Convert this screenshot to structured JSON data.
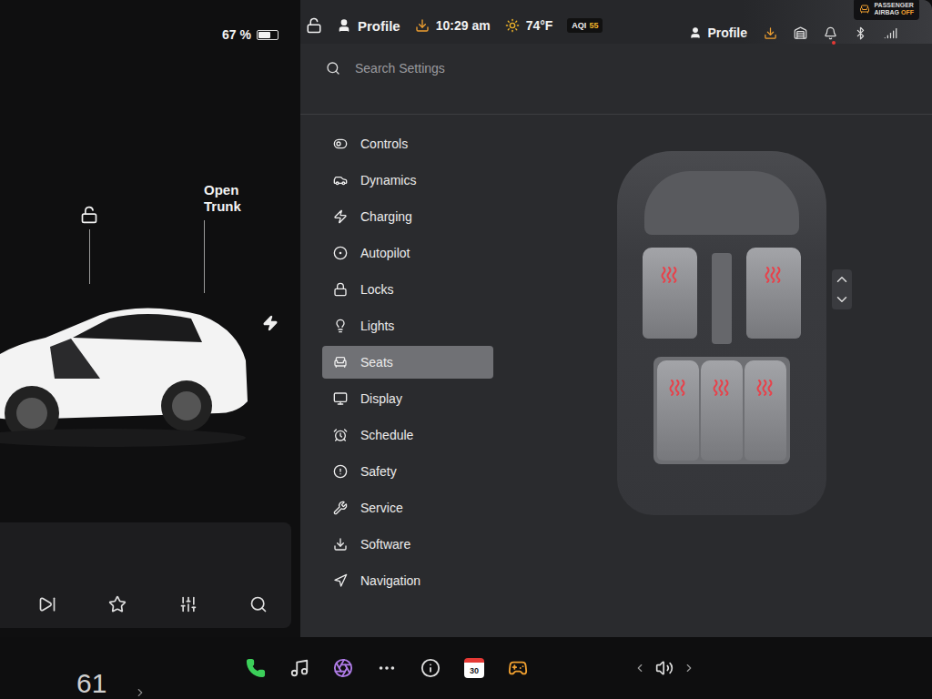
{
  "status": {
    "battery": "67 %",
    "battery_level": 0.67,
    "profile": "Profile",
    "time": "10:29 am",
    "temperature": "74°F",
    "aqi_label": "AQI",
    "aqi_value": "55",
    "locked": false,
    "update_available": true
  },
  "car": {
    "trunk": "Open Trunk",
    "locked": false
  },
  "settings": {
    "search_placeholder": "Search Settings",
    "profile": "Profile",
    "update_available": true,
    "unread_alerts": true,
    "airbag": {
      "line1": "PASSENGER",
      "line2": "AIRBAG",
      "state": "OFF"
    }
  },
  "menu": [
    {
      "label": "Controls",
      "selected": false
    },
    {
      "label": "Dynamics",
      "selected": false
    },
    {
      "label": "Charging",
      "selected": false
    },
    {
      "label": "Autopilot",
      "selected": false
    },
    {
      "label": "Locks",
      "selected": false
    },
    {
      "label": "Lights",
      "selected": false
    },
    {
      "label": "Seats",
      "selected": true
    },
    {
      "label": "Display",
      "selected": false
    },
    {
      "label": "Schedule",
      "selected": false
    },
    {
      "label": "Safety",
      "selected": false
    },
    {
      "label": "Service",
      "selected": false
    },
    {
      "label": "Software",
      "selected": false
    },
    {
      "label": "Navigation",
      "selected": false
    }
  ],
  "seats": {
    "front": [
      {
        "heat": 3
      },
      {
        "heat": 3
      }
    ],
    "rear": [
      {
        "heat": 3
      },
      {
        "heat": 3
      },
      {
        "heat": 3
      }
    ]
  },
  "speed": "61",
  "dock": {
    "calendar_day": "30"
  }
}
